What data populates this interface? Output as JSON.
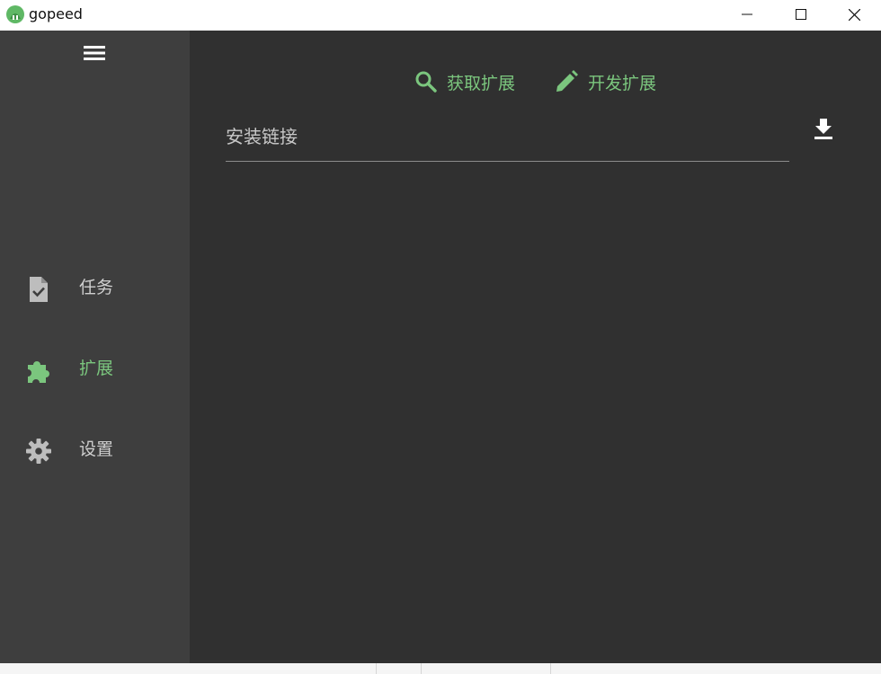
{
  "window": {
    "title": "gopeed",
    "accent_color": "#7bc67e"
  },
  "titlebar": {
    "logo_icon": "gopeed-logo-icon",
    "minimize_icon": "minimize-icon",
    "maximize_icon": "maximize-icon",
    "close_icon": "close-icon"
  },
  "sidebar": {
    "menu_icon": "menu-icon",
    "items": [
      {
        "label": "任务",
        "icon": "task-file-check-icon",
        "active": false
      },
      {
        "label": "扩展",
        "icon": "puzzle-extension-icon",
        "active": true
      },
      {
        "label": "设置",
        "icon": "gear-settings-icon",
        "active": false
      }
    ]
  },
  "main": {
    "toolbar": {
      "get_extension_label": "获取扩展",
      "get_extension_icon": "search-icon",
      "dev_extension_label": "开发扩展",
      "dev_extension_icon": "pencil-edit-icon"
    },
    "install": {
      "placeholder": "安装链接",
      "value": "",
      "button_icon": "download-icon"
    }
  }
}
